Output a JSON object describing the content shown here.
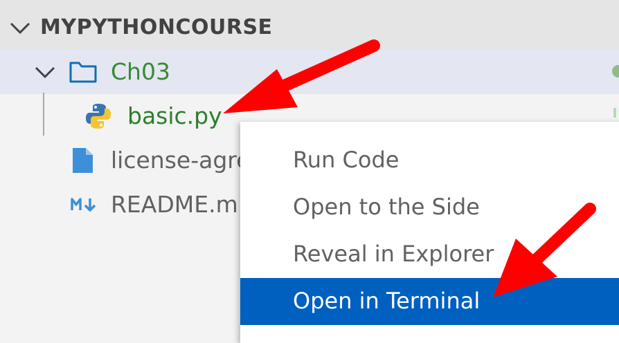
{
  "explorer": {
    "section_title": "MYPYTHONCOURSE",
    "items": [
      {
        "label": "Ch03",
        "icon": "folder-icon"
      },
      {
        "label": "basic.py",
        "icon": "python-file-icon"
      },
      {
        "label": "license-agre",
        "icon": "file-icon"
      },
      {
        "label": "README.m",
        "icon": "markdown-icon"
      }
    ]
  },
  "context_menu": {
    "items": [
      {
        "label": "Run Code"
      },
      {
        "label": "Open to the Side"
      },
      {
        "label": "Reveal in Explorer"
      },
      {
        "label": "Open in Terminal",
        "highlighted": true
      }
    ]
  },
  "colors": {
    "accent": "#0060c0",
    "folder_label": "#388a34",
    "annotation_arrow": "#ff0000"
  }
}
